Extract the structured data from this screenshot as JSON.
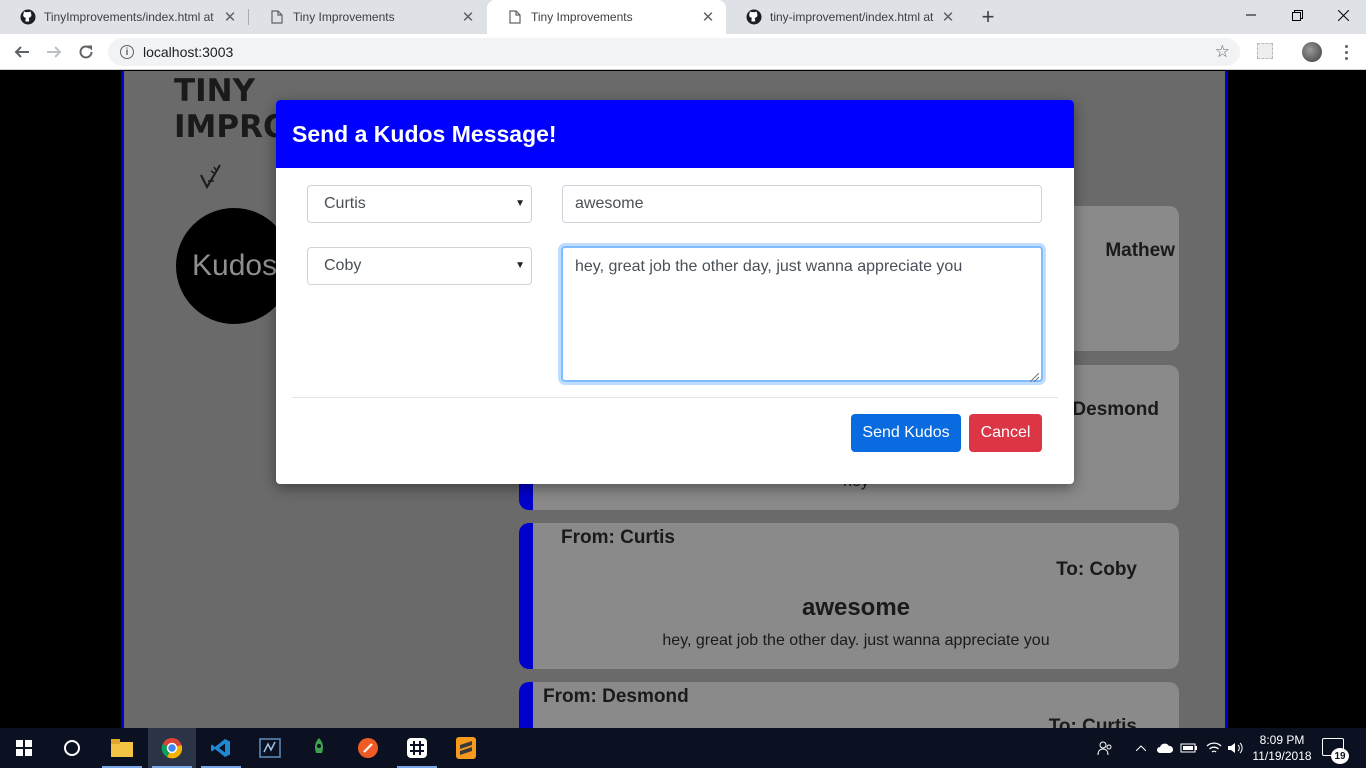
{
  "browser": {
    "tabs": [
      {
        "title": "TinyImprovements/index.html at",
        "icon": "github-icon"
      },
      {
        "title": "Tiny Improvements",
        "icon": "page-icon"
      },
      {
        "title": "Tiny Improvements",
        "icon": "page-icon"
      },
      {
        "title": "tiny-improvement/index.html at",
        "icon": "github-icon"
      }
    ],
    "address": "localhost:3003"
  },
  "page": {
    "brand_line1": "TINY",
    "brand_line2": "IMPROV",
    "kudos_circle": "Kudos",
    "cards": [
      {
        "to": "Mathew"
      },
      {
        "to": "Desmond",
        "message": "hey"
      },
      {
        "from": "From: Curtis",
        "to": "To: Coby",
        "subject": "awesome",
        "message": "hey, great job the other day. just wanna appreciate you"
      },
      {
        "from": "From: Desmond",
        "to": "To: Curtis"
      }
    ]
  },
  "modal": {
    "title": "Send a Kudos Message!",
    "from_select": "Curtis",
    "to_select": "Coby",
    "subject_value": "awesome",
    "message_value": "hey, great job the other day, just wanna appreciate you",
    "send_label": "Send Kudos",
    "cancel_label": "Cancel"
  },
  "taskbar": {
    "time": "8:09 PM",
    "date": "11/19/2018",
    "notification_count": "19"
  },
  "colors": {
    "modal_header": "#0000ff",
    "accent_border": "#0000cc",
    "send_button": "#0a6be0",
    "cancel_button": "#dc3545"
  }
}
